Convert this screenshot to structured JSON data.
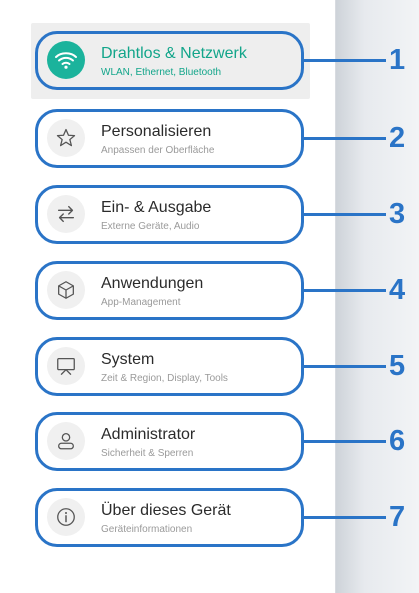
{
  "menu": {
    "items": [
      {
        "title": "Drahtlos & Netzwerk",
        "subtitle": "WLAN, Ethernet, Bluetooth",
        "icon": "wifi-icon",
        "active": true,
        "callout": "1"
      },
      {
        "title": "Personalisieren",
        "subtitle": "Anpassen der Oberfläche",
        "icon": "star-icon",
        "active": false,
        "callout": "2"
      },
      {
        "title": "Ein- & Ausgabe",
        "subtitle": "Externe Geräte, Audio",
        "icon": "swap-arrows-icon",
        "active": false,
        "callout": "3"
      },
      {
        "title": "Anwendungen",
        "subtitle": "App-Management",
        "icon": "cube-icon",
        "active": false,
        "callout": "4"
      },
      {
        "title": "System",
        "subtitle": "Zeit & Region, Display, Tools",
        "icon": "presentation-screen-icon",
        "active": false,
        "callout": "5"
      },
      {
        "title": "Administrator",
        "subtitle": "Sicherheit & Sperren",
        "icon": "user-icon",
        "active": false,
        "callout": "6"
      },
      {
        "title": "Über dieses Gerät",
        "subtitle": "Geräteinformationen",
        "icon": "info-icon",
        "active": false,
        "callout": "7"
      }
    ]
  },
  "colors": {
    "accent": "#1bb39c",
    "callout": "#2a74c7"
  }
}
